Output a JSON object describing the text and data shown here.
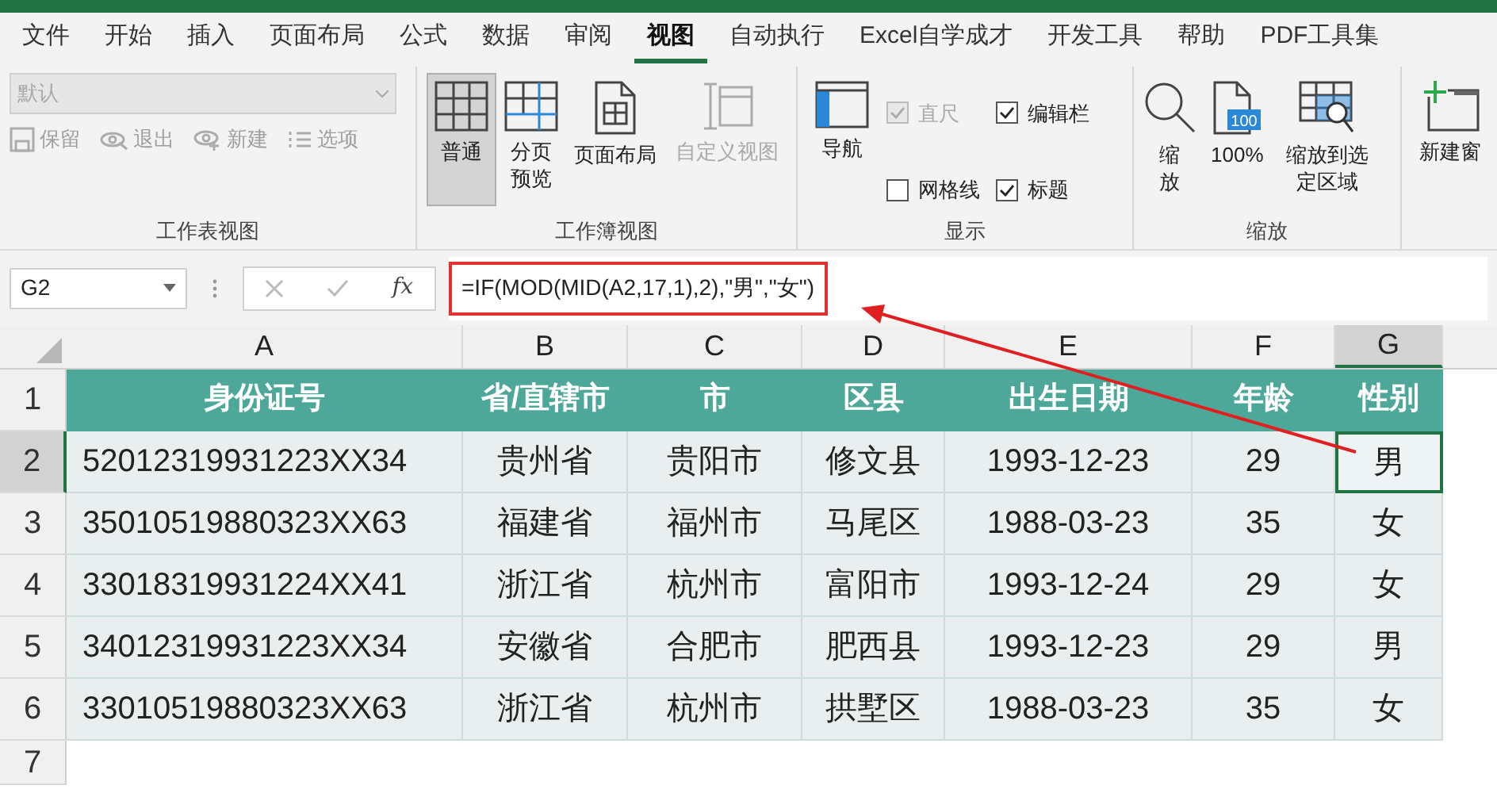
{
  "menu_tabs": [
    {
      "label": "文件",
      "selected": false
    },
    {
      "label": "开始",
      "selected": false
    },
    {
      "label": "插入",
      "selected": false
    },
    {
      "label": "页面布局",
      "selected": false
    },
    {
      "label": "公式",
      "selected": false
    },
    {
      "label": "数据",
      "selected": false
    },
    {
      "label": "审阅",
      "selected": false
    },
    {
      "label": "视图",
      "selected": true
    },
    {
      "label": "自动执行",
      "selected": false
    },
    {
      "label": "Excel自学成才",
      "selected": false
    },
    {
      "label": "开发工具",
      "selected": false
    },
    {
      "label": "帮助",
      "selected": false
    },
    {
      "label": "PDF工具集",
      "selected": false
    }
  ],
  "ribbon": {
    "sheet_view": {
      "title": "工作表视图",
      "dropdown": {
        "value": "默认",
        "disabled": true
      },
      "buttons": [
        {
          "kind": "save",
          "label": "保留",
          "disabled": true
        },
        {
          "kind": "exit",
          "label": "退出",
          "disabled": true
        },
        {
          "kind": "new",
          "label": "新建",
          "disabled": true
        },
        {
          "kind": "options",
          "label": "选项",
          "disabled": true
        }
      ]
    },
    "workbook_view": {
      "title": "工作簿视图",
      "buttons": [
        {
          "kind": "normal",
          "label": "普通",
          "selected": true,
          "disabled": false
        },
        {
          "kind": "page-break",
          "label": "分页预览",
          "selected": false,
          "disabled": false
        },
        {
          "kind": "page-layout",
          "label": "页面布局",
          "selected": false,
          "disabled": false
        },
        {
          "kind": "custom",
          "label": "自定义视图",
          "selected": false,
          "disabled": true
        }
      ]
    },
    "show": {
      "title": "显示",
      "navigation": {
        "label": "导航"
      },
      "checkboxes": [
        {
          "label": "直尺",
          "checked": true,
          "disabled": true
        },
        {
          "label": "编辑栏",
          "checked": true,
          "disabled": false
        },
        {
          "label": "网格线",
          "checked": false,
          "disabled": false
        },
        {
          "label": "标题",
          "checked": true,
          "disabled": false
        }
      ]
    },
    "zoom": {
      "title": "缩放",
      "buttons": [
        {
          "kind": "zoom",
          "label": "缩放"
        },
        {
          "kind": "zoom-100",
          "label": "100%",
          "badge": "100"
        },
        {
          "kind": "zoom-selection",
          "label": "缩放到选定区域"
        }
      ]
    },
    "window": {
      "buttons": [
        {
          "kind": "new-window",
          "label": "新建窗"
        }
      ]
    }
  },
  "formula_bar": {
    "name_box": "G2",
    "fx": "fx",
    "formula": "=IF(MOD(MID(A2,17,1),2),\"男\",\"女\")"
  },
  "sheet": {
    "columns": [
      {
        "label": "A",
        "selected": false
      },
      {
        "label": "B",
        "selected": false
      },
      {
        "label": "C",
        "selected": false
      },
      {
        "label": "D",
        "selected": false
      },
      {
        "label": "E",
        "selected": false
      },
      {
        "label": "F",
        "selected": false
      },
      {
        "label": "G",
        "selected": true
      }
    ],
    "header": [
      "身份证号",
      "省/直辖市",
      "市",
      "区县",
      "出生日期",
      "年龄",
      "性别"
    ],
    "rows": [
      {
        "number": "2",
        "selected": true,
        "cells": [
          "52012319931223XX34",
          "贵州省",
          "贵阳市",
          "修文县",
          "1993-12-23",
          "29",
          "男"
        ]
      },
      {
        "number": "3",
        "selected": false,
        "cells": [
          "35010519880323XX63",
          "福建省",
          "福州市",
          "马尾区",
          "1988-03-23",
          "35",
          "女"
        ]
      },
      {
        "number": "4",
        "selected": false,
        "cells": [
          "33018319931224XX41",
          "浙江省",
          "杭州市",
          "富阳市",
          "1993-12-24",
          "29",
          "女"
        ]
      },
      {
        "number": "5",
        "selected": false,
        "cells": [
          "34012319931223XX34",
          "安徽省",
          "合肥市",
          "肥西县",
          "1993-12-23",
          "29",
          "男"
        ]
      },
      {
        "number": "6",
        "selected": false,
        "cells": [
          "33010519880323XX63",
          "浙江省",
          "杭州市",
          "拱墅区",
          "1988-03-23",
          "35",
          "女"
        ]
      }
    ],
    "header_row_number": "1",
    "empty_row_number": "7"
  }
}
